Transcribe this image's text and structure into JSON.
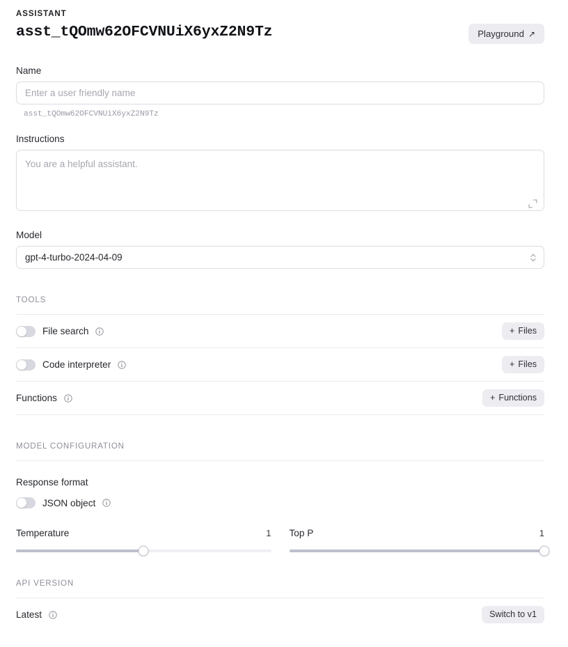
{
  "header": {
    "eyebrow": "ASSISTANT",
    "assistant_id": "asst_tQOmw62OFCVNUiX6yxZ2N9Tz",
    "playground_label": "Playground",
    "playground_icon": "external-link-arrow-icon"
  },
  "name_field": {
    "label": "Name",
    "value": "",
    "placeholder": "Enter a user friendly name",
    "helper": "asst_tQOmw62OFCVNUiX6yxZ2N9Tz"
  },
  "instructions_field": {
    "label": "Instructions",
    "value": "",
    "placeholder": "You are a helpful assistant.",
    "expand_icon": "expand-corner-icon"
  },
  "model_field": {
    "label": "Model",
    "value": "gpt-4-turbo-2024-04-09",
    "chevron_icon": "chevron-up-down-icon"
  },
  "tools": {
    "section_label": "TOOLS",
    "rows": [
      {
        "label": "File search",
        "toggle": "off",
        "info_icon": "info-circle-icon",
        "action_label": "Files",
        "action_icon": "plus-icon"
      },
      {
        "label": "Code interpreter",
        "toggle": "off",
        "info_icon": "info-circle-icon",
        "action_label": "Files",
        "action_icon": "plus-icon"
      },
      {
        "label": "Functions",
        "toggle": null,
        "info_icon": "info-circle-icon",
        "action_label": "Functions",
        "action_icon": "plus-icon"
      }
    ]
  },
  "model_configuration": {
    "section_label": "MODEL CONFIGURATION",
    "response_format_label": "Response format",
    "json_object_label": "JSON object",
    "json_object_toggle": "off",
    "json_info_icon": "info-circle-icon",
    "temperature": {
      "label": "Temperature",
      "value": "1",
      "percent": 50
    },
    "top_p": {
      "label": "Top P",
      "value": "1",
      "percent": 100
    }
  },
  "api_version": {
    "section_label": "API VERSION",
    "current_label": "Latest",
    "info_icon": "info-circle-icon",
    "switch_label": "Switch to v1"
  },
  "colors": {
    "text_primary": "#26282d",
    "text_muted": "#8e8f99",
    "placeholder": "#a6a7b0",
    "border": "#dcdce3",
    "divider": "#ebebef",
    "button_bg": "#ececf1",
    "toggle_off": "#d7d8e0",
    "slider_fill": "#bdbfcc",
    "slider_track": "#f0f0f4"
  }
}
